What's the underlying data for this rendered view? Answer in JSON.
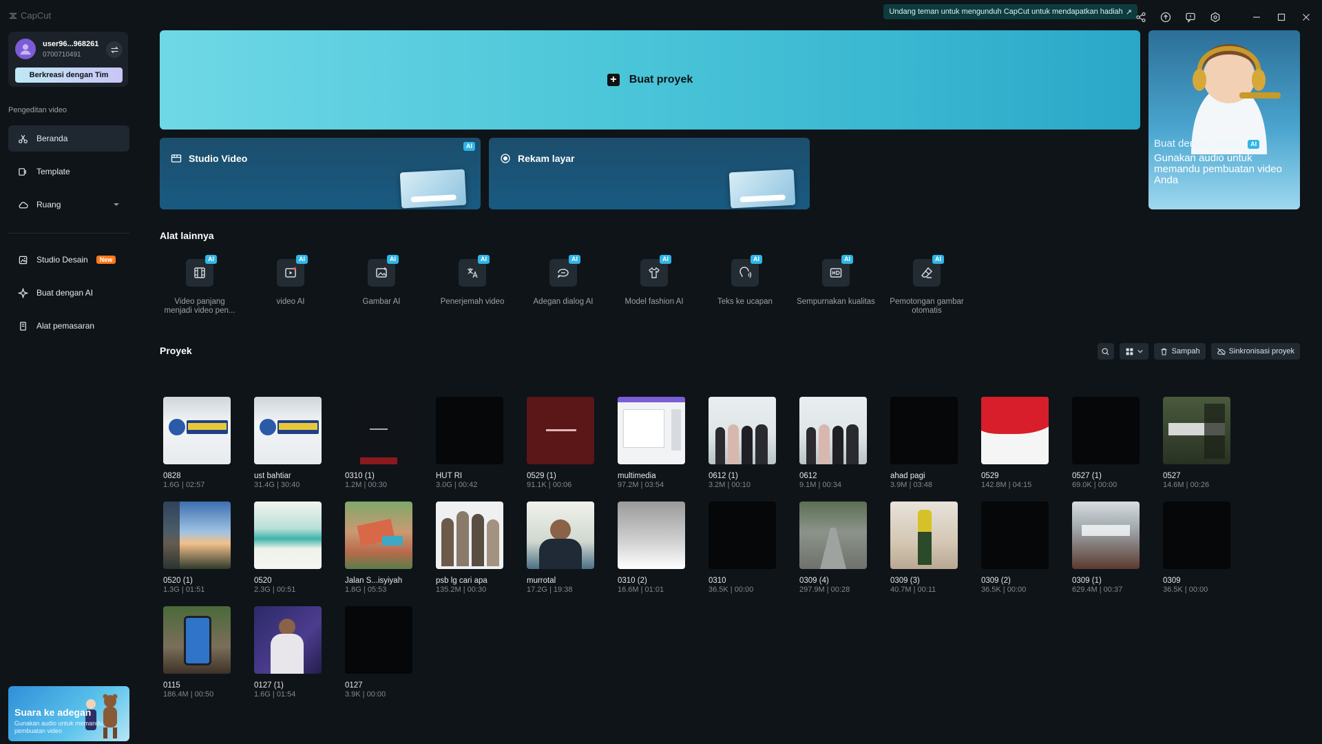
{
  "app": {
    "logo_text": "CapCut"
  },
  "titlebar": {
    "invite_text": "Undang teman untuk mengunduh CapCut untuk mendapatkan hadiah",
    "icons": [
      "share-icon",
      "upload-icon",
      "feedback-icon",
      "settings-icon",
      "minimize-icon",
      "maximize-icon",
      "close-icon"
    ]
  },
  "user": {
    "name": "user96...968261",
    "id": "0700710491",
    "team_button": "Berkreasi dengan Tim"
  },
  "sidebar": {
    "section_label": "Pengeditan video",
    "items": [
      {
        "label": "Beranda",
        "icon": "home-icon",
        "active": true
      },
      {
        "label": "Template",
        "icon": "template-icon"
      },
      {
        "label": "Ruang",
        "icon": "cloud-icon"
      },
      {
        "label": "Studio Desain",
        "icon": "design-icon",
        "badge": "New"
      },
      {
        "label": "Buat dengan AI",
        "icon": "sparkle-icon"
      },
      {
        "label": "Alat pemasaran",
        "icon": "marketing-icon"
      }
    ],
    "promo": {
      "title": "Suara ke adegan",
      "subtitle": "Gunakan audio untuk memandu pembuatan video"
    }
  },
  "hero": {
    "label": "Buat proyek"
  },
  "cards": {
    "studio": {
      "label": "Studio Video",
      "badge": "AI"
    },
    "record": {
      "label": "Rekam layar"
    }
  },
  "side_panel": {
    "title": "Buat dengan audio",
    "badge": "AI",
    "text": "Gunakan audio untuk memandu pembuatan video Anda"
  },
  "tools_section": {
    "title": "Alat lainnya",
    "items": [
      {
        "label": "Video panjang menjadi video pen...",
        "icon": "film-icon",
        "badge": "AI"
      },
      {
        "label": "video AI",
        "icon": "video-ai-icon",
        "badge": "AI"
      },
      {
        "label": "Gambar AI",
        "icon": "image-ai-icon",
        "badge": "AI"
      },
      {
        "label": "Penerjemah video",
        "icon": "translate-icon",
        "badge": "AI"
      },
      {
        "label": "Adegan dialog AI",
        "icon": "dialog-icon",
        "badge": "AI"
      },
      {
        "label": "Model fashion AI",
        "icon": "shirt-icon",
        "badge": "AI"
      },
      {
        "label": "Teks ke ucapan",
        "icon": "speech-icon",
        "badge": "AI"
      },
      {
        "label": "Sempurnakan kualitas",
        "icon": "hd-icon",
        "badge": "AI"
      },
      {
        "label": "Pemotongan gambar otomatis",
        "icon": "eraser-icon",
        "badge": "AI"
      }
    ]
  },
  "projects": {
    "title": "Proyek",
    "trash_label": "Sampah",
    "sync_label": "Sinkronisasi proyek",
    "items": [
      {
        "name": "0828",
        "meta": "1.6G | 02:57",
        "thumb": "banner"
      },
      {
        "name": "ust bahtiar",
        "meta": "31.4G | 30:40",
        "thumb": "banner"
      },
      {
        "name": "0310 (1)",
        "meta": "1.2M | 00:30",
        "thumb": "dark-red"
      },
      {
        "name": "HUT RI",
        "meta": "3.0G | 00:42",
        "thumb": "black"
      },
      {
        "name": "0529 (1)",
        "meta": "91.1K | 00:06",
        "thumb": "maroon"
      },
      {
        "name": "multimedia",
        "meta": "97.2M | 03:54",
        "thumb": "screen"
      },
      {
        "name": "0612 (1)",
        "meta": "3.2M | 00:10",
        "thumb": "group"
      },
      {
        "name": "0612",
        "meta": "9.1M | 00:34",
        "thumb": "group"
      },
      {
        "name": "ahad pagi",
        "meta": "3.9M | 03:48",
        "thumb": "black"
      },
      {
        "name": "0529",
        "meta": "142.8M | 04:15",
        "thumb": "flag"
      },
      {
        "name": "0527 (1)",
        "meta": "69.0K | 00:00",
        "thumb": "black"
      },
      {
        "name": "0527",
        "meta": "14.6M | 00:26",
        "thumb": "poster"
      },
      {
        "name": "0520 (1)",
        "meta": "1.3G | 01:51",
        "thumb": "sky"
      },
      {
        "name": "0520",
        "meta": "2.3G | 00:51",
        "thumb": "blur"
      },
      {
        "name": "Jalan S...isyiyah",
        "meta": "1.8G | 05:53",
        "thumb": "aerial"
      },
      {
        "name": "psb lg cari apa",
        "meta": "135.2M | 00:30",
        "thumb": "people"
      },
      {
        "name": "murrotal",
        "meta": "17.2G | 19:38",
        "thumb": "person"
      },
      {
        "name": "0310 (2)",
        "meta": "16.6M | 01:01",
        "thumb": "gradient"
      },
      {
        "name": "0310",
        "meta": "36.5K | 00:00",
        "thumb": "black"
      },
      {
        "name": "0309 (4)",
        "meta": "297.9M | 00:28",
        "thumb": "road"
      },
      {
        "name": "0309 (3)",
        "meta": "40.7M | 00:11",
        "thumb": "standing"
      },
      {
        "name": "0309 (2)",
        "meta": "36.5K | 00:00",
        "thumb": "black"
      },
      {
        "name": "0309 (1)",
        "meta": "629.4M | 00:37",
        "thumb": "room"
      },
      {
        "name": "0309",
        "meta": "36.5K | 00:00",
        "thumb": "black"
      },
      {
        "name": "0115",
        "meta": "186.4M | 00:50",
        "thumb": "phone"
      },
      {
        "name": "0127 (1)",
        "meta": "1.6G | 01:54",
        "thumb": "purple"
      },
      {
        "name": "0127",
        "meta": "3.9K | 00:00",
        "thumb": "black"
      }
    ]
  },
  "colors": {
    "background": "#0f1419",
    "hero_start": "#6fd8e6",
    "hero_end": "#2aa7c7",
    "ai_badge": "#2fb6e8",
    "new_badge": "#ff7a1a"
  }
}
